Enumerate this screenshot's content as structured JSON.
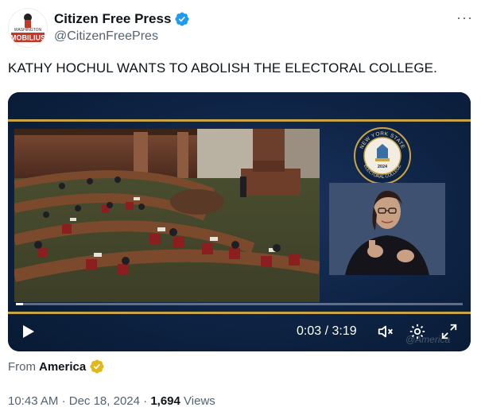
{
  "account": {
    "display_name": "Citizen Free Press",
    "handle": "@CitizenFreePres",
    "avatar_text": "MOBILIUS",
    "avatar_top_text": "WASHINGTON"
  },
  "more_label": "···",
  "tweet": {
    "text": "KATHY HOCHUL WANTS TO ABOLISH THE ELECTORAL COLLEGE."
  },
  "video": {
    "time_label": "0:03 / 3:19",
    "progress_fraction": 0.016,
    "seal_top_text": "NEW YORK STATE",
    "seal_bottom_text": "ELECTORAL COLLEGE",
    "seal_year": "2024",
    "watermark": "@America"
  },
  "source": {
    "prefix": "From",
    "name": "America"
  },
  "meta": {
    "time": "10:43 AM",
    "date": "Dec 18, 2024",
    "views_count": "1,694",
    "views_label": "Views",
    "separator": "·"
  },
  "colors": {
    "verified_blue": "#1d9bf0",
    "gold_badge": "#e2b719",
    "video_navy": "#0e2344",
    "gold_line": "#c9a443",
    "muted_text": "#536471"
  },
  "icons": [
    "verified-badge-icon",
    "more-icon",
    "play-icon",
    "mute-icon",
    "settings-icon",
    "fullscreen-icon",
    "gold-badge-icon"
  ]
}
